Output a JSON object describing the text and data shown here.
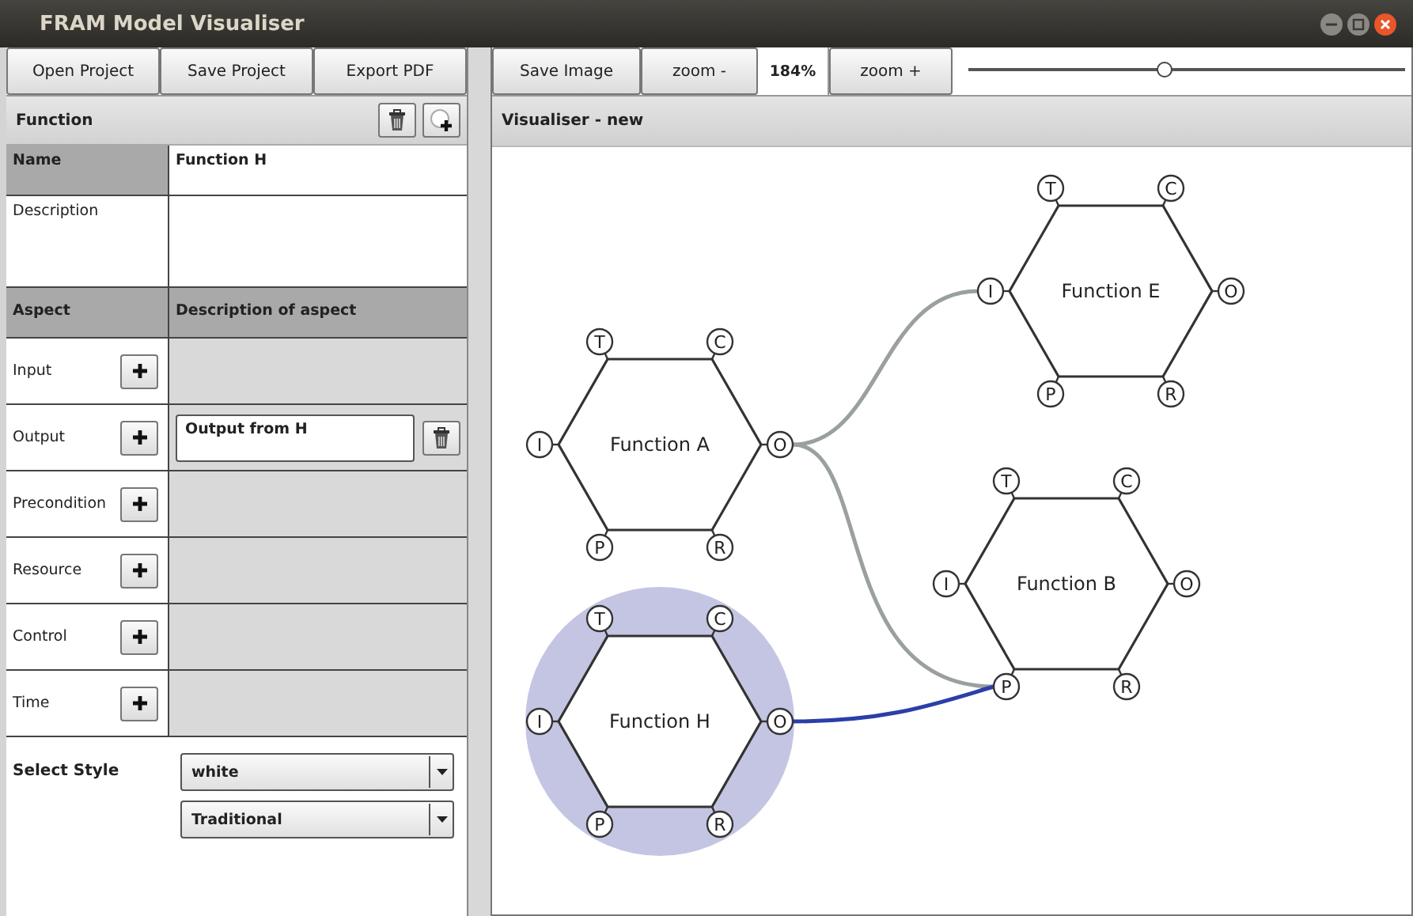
{
  "window": {
    "title": "FRAM Model Visualiser"
  },
  "left_toolbar": [
    "Open Project",
    "Save Project",
    "Export PDF"
  ],
  "function_panel": {
    "title": "Function",
    "name_label": "Name",
    "name_value": "Function H",
    "description_label": "Description",
    "aspect_header": "Aspect",
    "aspect_description_header": "Description of aspect",
    "aspects": [
      {
        "label": "Input"
      },
      {
        "label": "Output",
        "entries": [
          "Output from H"
        ]
      },
      {
        "label": "Precondition"
      },
      {
        "label": "Resource"
      },
      {
        "label": "Control"
      },
      {
        "label": "Time"
      }
    ]
  },
  "style": {
    "label": "Select Style",
    "selects": [
      "white",
      "Traditional"
    ]
  },
  "right_toolbar": {
    "save_image": "Save Image",
    "zoom_out": "zoom -",
    "zoom_value": "184%",
    "zoom_in": "zoom +",
    "zoom_slider": {
      "level": 0.45
    }
  },
  "visualiser": {
    "title": "Visualiser - new",
    "nodes": [
      {
        "label": "Function A",
        "ports": [
          "T",
          "C",
          "I",
          "O",
          "P",
          "R"
        ],
        "selected": false
      },
      {
        "label": "Function E",
        "ports": [
          "T",
          "C",
          "I",
          "O",
          "P",
          "R"
        ],
        "selected": false
      },
      {
        "label": "Function B",
        "ports": [
          "T",
          "C",
          "I",
          "O",
          "P",
          "R"
        ],
        "selected": false
      },
      {
        "label": "Function H",
        "ports": [
          "T",
          "C",
          "I",
          "O",
          "P",
          "R"
        ],
        "selected": true
      }
    ],
    "connections": [
      {
        "selected": false
      },
      {
        "selected": false
      },
      {
        "selected": true
      }
    ]
  }
}
